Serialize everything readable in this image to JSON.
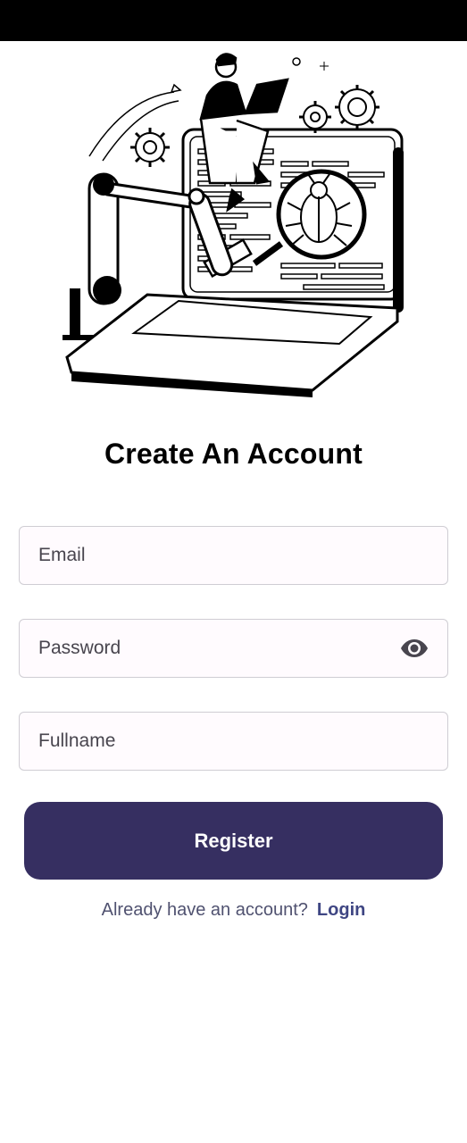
{
  "page": {
    "title": "Create An Account"
  },
  "form": {
    "email": {
      "placeholder": "Email",
      "value": ""
    },
    "password": {
      "placeholder": "Password",
      "value": "",
      "toggle_icon": "eye-icon"
    },
    "fullname": {
      "placeholder": "Fullname",
      "value": ""
    },
    "register_label": "Register"
  },
  "footer": {
    "prompt": "Already have an account?",
    "login_label": "Login"
  },
  "colors": {
    "primary": "#362f61",
    "link": "#3f4683",
    "field_bg": "#fffbfe",
    "field_border": "#cfcdd3",
    "status_bar": "#000000"
  }
}
